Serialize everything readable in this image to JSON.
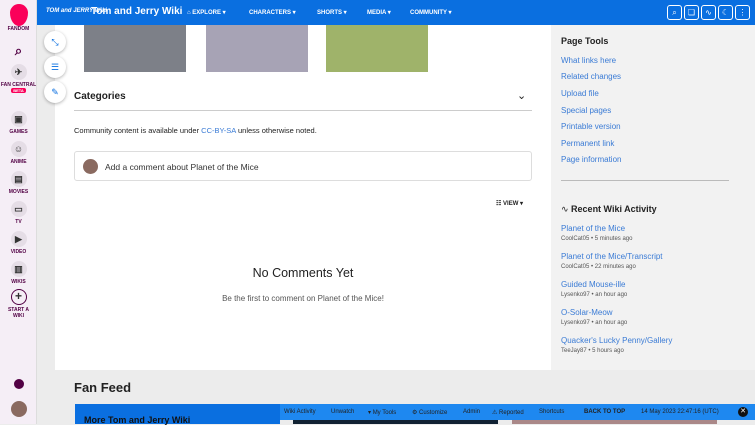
{
  "rail": {
    "fandom": "FANDOM",
    "items": [
      {
        "label": "FAN CENTRAL",
        "badge": "BETA",
        "icon": "rocket-icon"
      },
      {
        "label": "GAMES",
        "icon": "gamepad-icon"
      },
      {
        "label": "ANIME",
        "icon": "anime-icon"
      },
      {
        "label": "MOVIES",
        "icon": "clapper-icon"
      },
      {
        "label": "TV",
        "icon": "tv-icon"
      },
      {
        "label": "VIDEO",
        "icon": "play-icon"
      },
      {
        "label": "WIKIS",
        "icon": "book-icon"
      },
      {
        "label": "START A WIKI",
        "icon": "plus-icon"
      }
    ]
  },
  "header": {
    "logo": "TOM and JERRY Wiki",
    "title": "Tom and Jerry Wiki",
    "nav": [
      "EXPLORE",
      "CHARACTERS",
      "SHORTS",
      "MEDIA",
      "COMMUNITY"
    ]
  },
  "main": {
    "categories": "Categories",
    "license_pre": "Community content is available under ",
    "license_link": "CC-BY-SA",
    "license_post": " unless otherwise noted.",
    "comment_placeholder": "Add a comment about Planet of the Mice",
    "view": "VIEW",
    "no_comments": "No Comments Yet",
    "be_first": "Be the first to comment on Planet of the Mice!"
  },
  "page_tools": {
    "title": "Page Tools",
    "links": [
      "What links here",
      "Related changes",
      "Upload file",
      "Special pages",
      "Printable version",
      "Permanent link",
      "Page information"
    ]
  },
  "activity": {
    "title": "Recent Wiki Activity",
    "items": [
      {
        "title": "Planet of the Mice",
        "meta": "CoolCat05 • 5 minutes ago"
      },
      {
        "title": "Planet of the Mice/Transcript",
        "meta": "CoolCat05 • 22 minutes ago"
      },
      {
        "title": "Guided Mouse-ille",
        "meta": "Lysenko97 • an hour ago"
      },
      {
        "title": "O-Solar-Meow",
        "meta": "Lysenko97 • an hour ago"
      },
      {
        "title": "Quacker's Lucky Penny/Gallery",
        "meta": "TeeJay87 • 5 hours ago"
      }
    ]
  },
  "fanfeed": {
    "title": "Fan Feed",
    "card": "More Tom and Jerry Wiki"
  },
  "toolbar": {
    "items": [
      "Wiki Activity",
      "Unwatch",
      "My Tools",
      "Customize",
      "Admin",
      "Reported",
      "Shortcuts"
    ],
    "back_to_top": "BACK TO TOP",
    "timestamp": "14 May 2023 22:47:16 (UTC)"
  }
}
